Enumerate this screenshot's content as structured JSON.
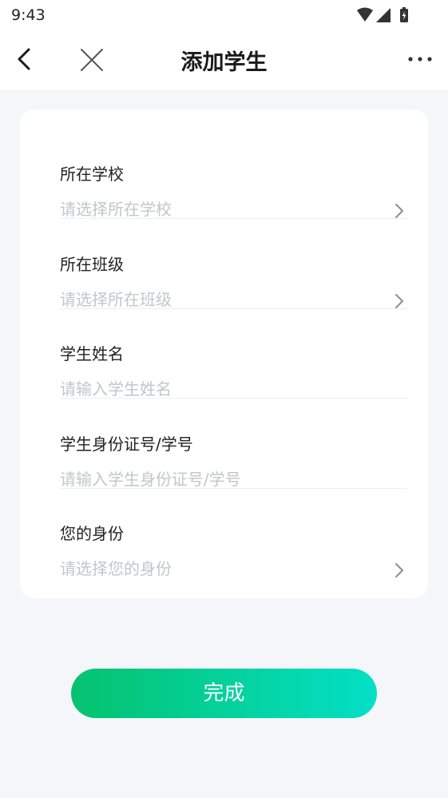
{
  "status_bar": {
    "time": "9:43",
    "icons": [
      "wifi-icon",
      "signal-icon",
      "battery-charging-icon"
    ]
  },
  "nav": {
    "title": "添加学生",
    "back_icon": "chevron-left-icon",
    "close_icon": "close-icon",
    "more_icon": "more-horizontal-icon"
  },
  "form": {
    "rows": [
      {
        "label": "所在学校",
        "placeholder": "请选择所在学校",
        "has_chevron": true
      },
      {
        "label": "所在班级",
        "placeholder": "请选择所在班级",
        "has_chevron": true
      },
      {
        "label": "学生姓名",
        "placeholder": "请输入学生姓名",
        "has_chevron": false
      },
      {
        "label": "学生身份证号/学号",
        "placeholder": "请输入学生身份证号/学号",
        "has_chevron": false
      },
      {
        "label": "您的身份",
        "placeholder": "请选择您的身份",
        "has_chevron": true
      }
    ]
  },
  "submit": {
    "label": "完成"
  },
  "colors": {
    "background": "#f4f6fa",
    "card": "#ffffff",
    "placeholder": "#c2c5cc",
    "gradient_start": "#05c26e",
    "gradient_end": "#03e0c6"
  }
}
